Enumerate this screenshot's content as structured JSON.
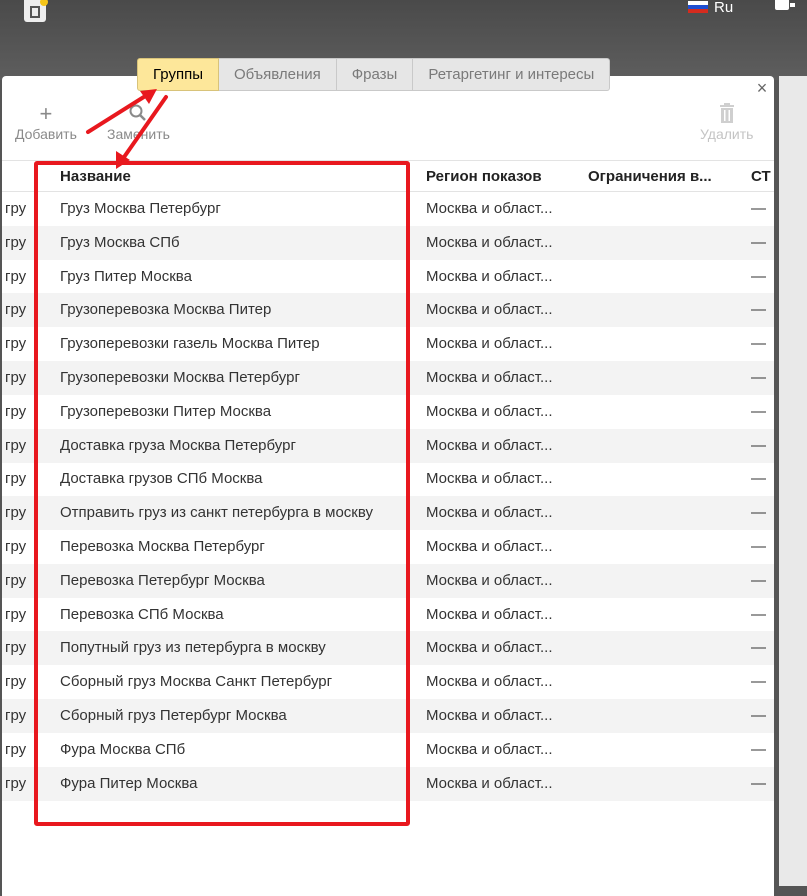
{
  "topbar": {
    "language": "Ru",
    "flag_colors": [
      "#ffffff",
      "#1f4fd1",
      "#d52b1e"
    ]
  },
  "tabs": [
    {
      "label": "Группы",
      "active": true
    },
    {
      "label": "Объявления",
      "active": false
    },
    {
      "label": "Фразы",
      "active": false
    },
    {
      "label": "Ретаргетинг и интересы",
      "active": false
    }
  ],
  "toolbar": {
    "add_label": "Добавить",
    "add_icon": "+",
    "replace_label": "Заменить",
    "replace_icon": "search-icon",
    "delete_label": "Удалить",
    "delete_icon": "trash-icon"
  },
  "close_symbol": "×",
  "table": {
    "columns": [
      "Название",
      "Регион показов",
      "Ограничения в...",
      "СТ"
    ],
    "rows": [
      {
        "prefix": "гру",
        "name": "Груз Москва Петербург",
        "region": "Москва и област...",
        "limits": "",
        "st": "—"
      },
      {
        "prefix": "гру",
        "name": "Груз Москва СПб",
        "region": "Москва и област...",
        "limits": "",
        "st": "—"
      },
      {
        "prefix": "гру",
        "name": "Груз Питер Москва",
        "region": "Москва и област...",
        "limits": "",
        "st": "—"
      },
      {
        "prefix": "гру",
        "name": "Грузоперевозка Москва Питер",
        "region": "Москва и област...",
        "limits": "",
        "st": "—"
      },
      {
        "prefix": "гру",
        "name": "Грузоперевозки газель Москва Питер",
        "region": "Москва и област...",
        "limits": "",
        "st": "—"
      },
      {
        "prefix": "гру",
        "name": "Грузоперевозки Москва Петербург",
        "region": "Москва и област...",
        "limits": "",
        "st": "—"
      },
      {
        "prefix": "гру",
        "name": "Грузоперевозки Питер Москва",
        "region": "Москва и област...",
        "limits": "",
        "st": "—"
      },
      {
        "prefix": "гру",
        "name": "Доставка груза Москва Петербург",
        "region": "Москва и област...",
        "limits": "",
        "st": "—"
      },
      {
        "prefix": "гру",
        "name": "Доставка грузов СПб Москва",
        "region": "Москва и област...",
        "limits": "",
        "st": "—"
      },
      {
        "prefix": "гру",
        "name": "Отправить груз из санкт петербурга в москву",
        "region": "Москва и област...",
        "limits": "",
        "st": "—"
      },
      {
        "prefix": "гру",
        "name": "Перевозка Москва Петербург",
        "region": "Москва и област...",
        "limits": "",
        "st": "—"
      },
      {
        "prefix": "гру",
        "name": "Перевозка Петербург Москва",
        "region": "Москва и област...",
        "limits": "",
        "st": "—"
      },
      {
        "prefix": "гру",
        "name": "Перевозка СПб Москва",
        "region": "Москва и област...",
        "limits": "",
        "st": "—"
      },
      {
        "prefix": "гру",
        "name": "Попутный груз из петербурга в москву",
        "region": "Москва и област...",
        "limits": "",
        "st": "—"
      },
      {
        "prefix": "гру",
        "name": "Сборный груз Москва Санкт Петербург",
        "region": "Москва и област...",
        "limits": "",
        "st": "—"
      },
      {
        "prefix": "гру",
        "name": "Сборный груз Петербург Москва",
        "region": "Москва и област...",
        "limits": "",
        "st": "—"
      },
      {
        "prefix": "гру",
        "name": "Фура Москва СПб",
        "region": "Москва и област...",
        "limits": "",
        "st": "—"
      },
      {
        "prefix": "гру",
        "name": "Фура Питер Москва",
        "region": "Москва и област...",
        "limits": "",
        "st": "—"
      }
    ]
  },
  "annotation": {
    "color": "#e8181e"
  }
}
